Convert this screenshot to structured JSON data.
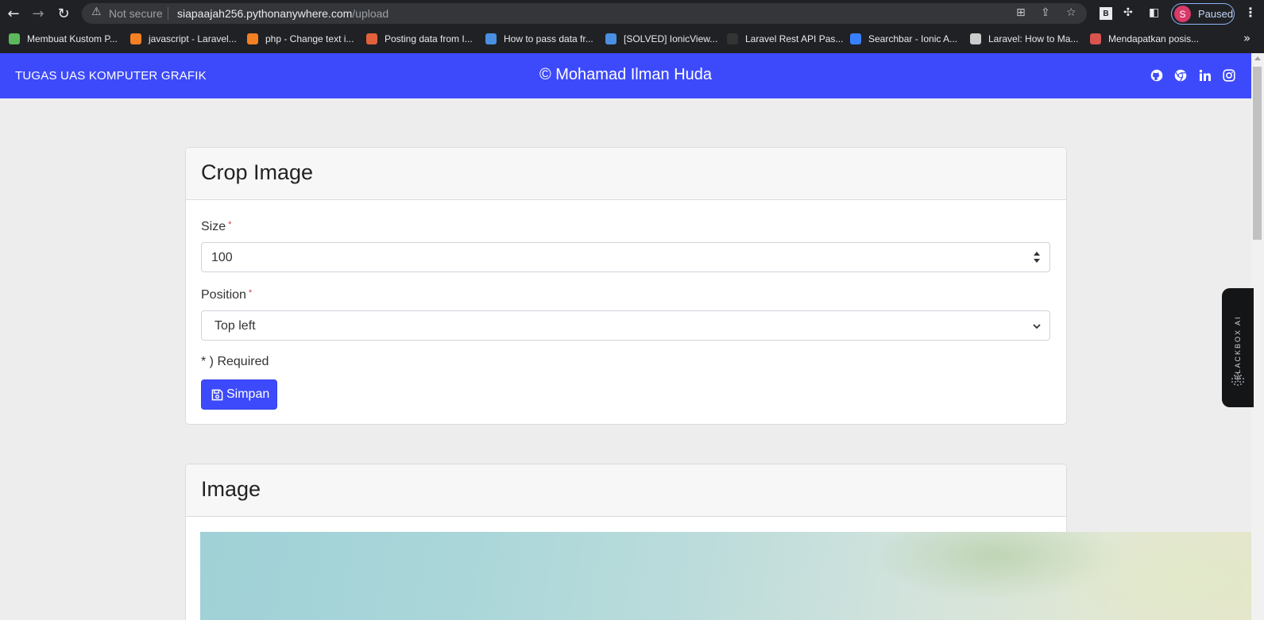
{
  "browser": {
    "security_label": "Not secure",
    "url_host": "siapaajah256.pythonanywhere.com",
    "url_path": "/upload",
    "profile_initial": "S",
    "profile_status": "Paused",
    "extension_b": "B",
    "bookmarks": [
      {
        "label": "Membuat Kustom P...",
        "color": "#5cb85c"
      },
      {
        "label": "javascript - Laravel...",
        "color": "#f48024"
      },
      {
        "label": "php - Change text i...",
        "color": "#f48024"
      },
      {
        "label": "Posting data from I...",
        "color": "#e2613c"
      },
      {
        "label": "How to pass data fr...",
        "color": "#4a90e2"
      },
      {
        "label": "[SOLVED] IonicView...",
        "color": "#4a90e2"
      },
      {
        "label": "Laravel Rest API Pas...",
        "color": "#333333"
      },
      {
        "label": "Searchbar - Ionic A...",
        "color": "#3880ff"
      },
      {
        "label": "Laravel: How to Ma...",
        "color": "#cccccc"
      },
      {
        "label": "Mendapatkan posis...",
        "color": "#d9534f"
      }
    ]
  },
  "navbar": {
    "brand": "TUGAS UAS KOMPUTER GRAFIK",
    "center": "© Mohamad Ilman Huda",
    "bg": "#3d4afb"
  },
  "crop_form": {
    "title": "Crop Image",
    "size_label": "Size",
    "size_value": "100",
    "position_label": "Position",
    "position_value": "Top left",
    "required_mark": "*",
    "required_note": "* ) Required",
    "submit_label": "Simpan"
  },
  "image_card": {
    "title": "Image"
  },
  "widget": {
    "label": "BLACKBOX AI"
  }
}
